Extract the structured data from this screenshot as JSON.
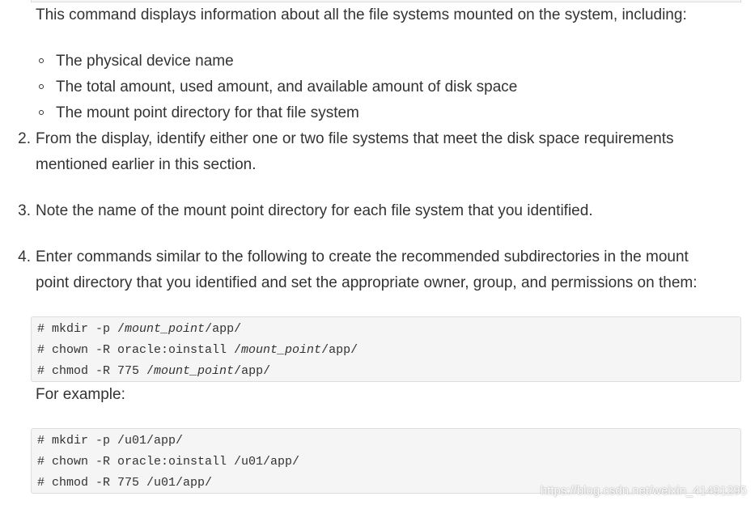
{
  "intro": {
    "text": "This command displays information about all the file systems mounted on the system, including:"
  },
  "bullets": [
    "The physical device name",
    "The total amount, used amount, and available amount of disk space",
    "The mount point directory for that file system"
  ],
  "steps": [
    {
      "number": "2.",
      "line1": "From the display, identify either one or two file systems that meet the disk space requirements",
      "line2": "mentioned earlier in this section."
    },
    {
      "number": "3.",
      "line1": "Note the name of the mount point directory for each file system that you identified."
    },
    {
      "number": "4.",
      "line1": "Enter commands similar to the following to create the recommended subdirectories in the mount",
      "line2": "point directory that you identified and set the appropriate owner, group, and permissions on them:"
    }
  ],
  "code_generic": {
    "line1": {
      "prefix": "# mkdir -p /",
      "var": "mount_point",
      "suffix": "/app/"
    },
    "line2": {
      "prefix": "# chown -R oracle:oinstall /",
      "var": "mount_point",
      "suffix": "/app/"
    },
    "line3": {
      "prefix": "# chmod -R 775 /",
      "var": "mount_point",
      "suffix": "/app/"
    }
  },
  "example_label": "For example:",
  "code_example": [
    "# mkdir -p /u01/app/",
    "# chown -R oracle:oinstall /u01/app/",
    "# chmod -R 775 /u01/app/"
  ],
  "watermark": "https://blog.csdn.net/weixin_41491295"
}
